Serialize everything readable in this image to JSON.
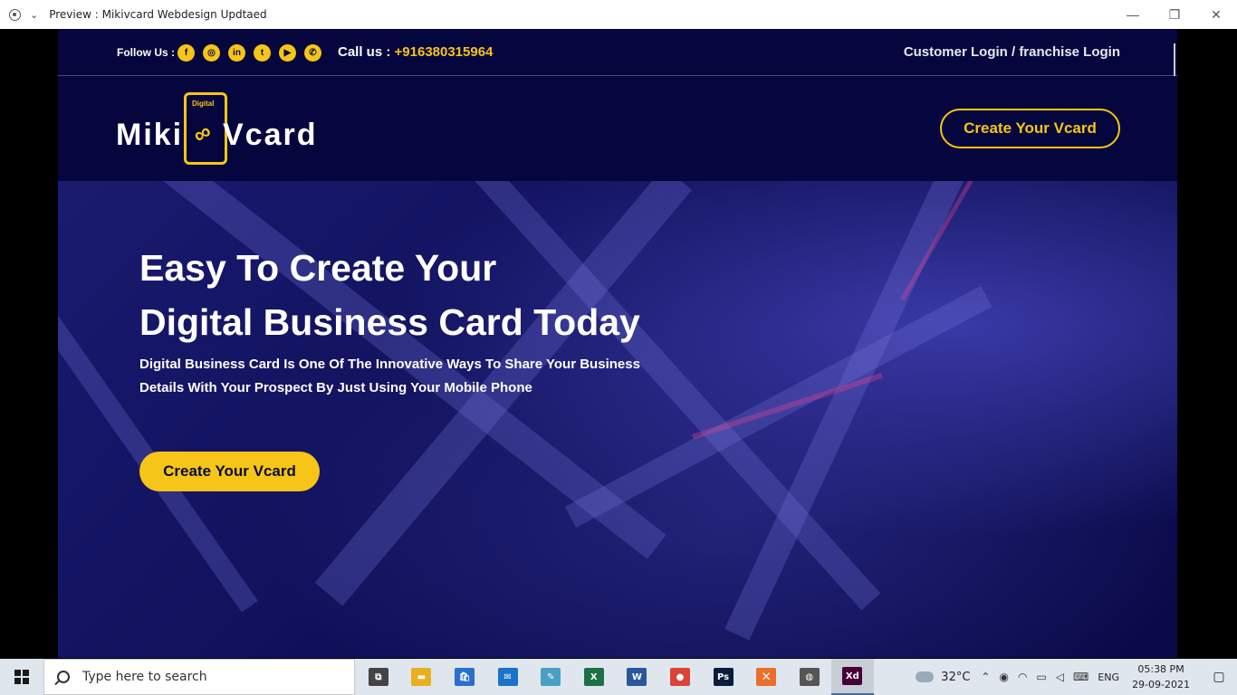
{
  "window": {
    "title": "Preview : Mikivcard Webdesign Updtaed",
    "minimize_glyph": "—",
    "restore_glyph": "❐",
    "close_glyph": "✕"
  },
  "topbar": {
    "follow_label": "Follow Us :",
    "socials": [
      {
        "icon": "facebook-icon",
        "glyph": "f"
      },
      {
        "icon": "instagram-icon",
        "glyph": "◎"
      },
      {
        "icon": "linkedin-icon",
        "glyph": "in"
      },
      {
        "icon": "twitter-icon",
        "glyph": "t"
      },
      {
        "icon": "youtube-icon",
        "glyph": "▶"
      },
      {
        "icon": "whatsapp-icon",
        "glyph": "✆"
      }
    ],
    "call_label": "Call us :",
    "call_number": "+916380315964",
    "login_text": "Customer Login / franchise Login"
  },
  "navbar": {
    "logo_digital": "Digital",
    "logo_part1": "Miki",
    "logo_part2": "Vcard",
    "cta_label": "Create Your Vcard"
  },
  "hero": {
    "heading_line1": "Easy To Create Your",
    "heading_line2": "Digital Business Card Today",
    "text_line1": "Digital Business Card Is One Of The Innovative Ways To Share Your Business",
    "text_line2": "Details With Your Prospect By Just Using Your Mobile Phone",
    "cta_label": "Create Your Vcard"
  },
  "taskbar": {
    "search_placeholder": "Type here to search",
    "apps": [
      {
        "icon": "task-view-icon",
        "glyph": "⧉",
        "color": "#444444"
      },
      {
        "icon": "file-explorer-icon",
        "glyph": "▬",
        "color": "#e8b020"
      },
      {
        "icon": "store-icon",
        "glyph": "🛍",
        "color": "#2a6fcf"
      },
      {
        "icon": "mail-icon",
        "glyph": "✉",
        "color": "#1a73c8"
      },
      {
        "icon": "notes-icon",
        "glyph": "✎",
        "color": "#4aa0c0"
      },
      {
        "icon": "excel-icon",
        "glyph": "X",
        "color": "#1d7044"
      },
      {
        "icon": "word-icon",
        "glyph": "W",
        "color": "#2b579a"
      },
      {
        "icon": "chrome-icon",
        "glyph": "●",
        "color": "#db4437"
      },
      {
        "icon": "photoshop-icon",
        "glyph": "Ps",
        "color": "#0a1d3a"
      },
      {
        "icon": "xampp-icon",
        "glyph": "⨉",
        "color": "#e8702a"
      },
      {
        "icon": "app-icon",
        "glyph": "◍",
        "color": "#555555"
      },
      {
        "icon": "adobe-xd-icon",
        "glyph": "Xd",
        "color": "#470137"
      }
    ],
    "weather": "32°C",
    "language": "ENG",
    "time": "05:38 PM",
    "date": "29-09-2021"
  },
  "colors": {
    "accent": "#f5c518",
    "page_bg": "#06063e"
  }
}
